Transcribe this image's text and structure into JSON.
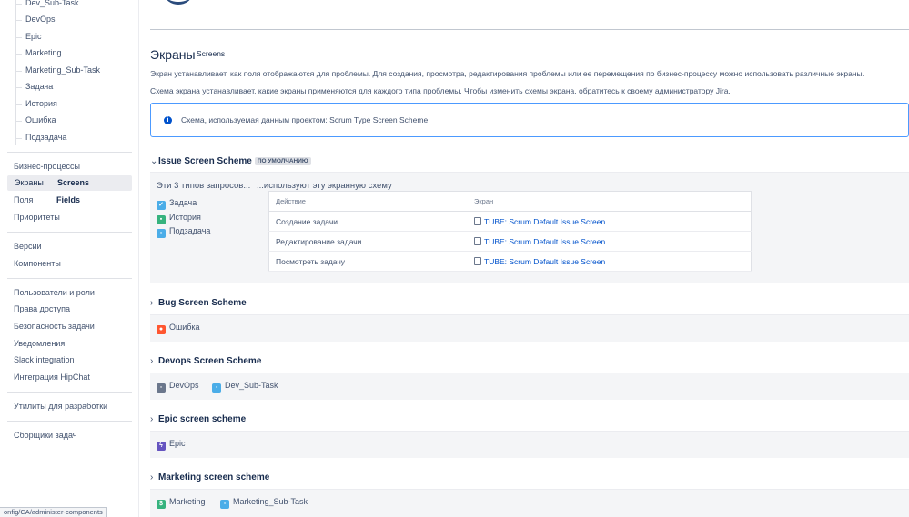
{
  "sidebar": {
    "sub_items": [
      "Dev_Sub-Task",
      "DevOps",
      "Epic",
      "Marketing",
      "Marketing_Sub-Task",
      "Задача",
      "История",
      "Ошибка",
      "Подзадача"
    ],
    "group1": [
      {
        "label": "Бизнес-процессы"
      },
      {
        "label": "Экраны",
        "en": "Screens"
      },
      {
        "label": "Поля",
        "en": "Fields"
      },
      {
        "label": "Приоритеты"
      }
    ],
    "group2": [
      "Версии",
      "Компоненты"
    ],
    "group3": [
      "Пользователи и роли",
      "Права доступа",
      "Безопасность задачи",
      "Уведомления",
      "Slack integration",
      "Интеграция HipChat"
    ],
    "group4": [
      "Утилиты для разработки"
    ],
    "group5": [
      "Сборщики задач"
    ]
  },
  "statusbar": "onfig/CA/administer-components",
  "main": {
    "title": "Экраны",
    "title_en": "Screens",
    "desc1": "Экран устанавливает, как поля отображаются для проблемы. Для создания, просмотра, редактирования проблемы или ее перемещения по бизнес-процессу можно использовать различные экраны.",
    "desc2": "Схема экрана устанавливает, какие экраны применяются для каждого типа проблемы. Чтобы изменить схемы экрана, обратитесь к своему администратору Jira.",
    "info": "Схема, используемая данным проектом: Scrum Type Screen Scheme"
  },
  "schemes": {
    "issue": {
      "title": "Issue Screen Scheme",
      "badge": "ПО УМОЛЧАНИЮ",
      "types_head": "Эти 3 типов запросов...",
      "uses_head": "...используют эту экранную схему",
      "types": [
        "Задача",
        "История",
        "Подзадача"
      ],
      "col_action": "Действие",
      "col_screen": "Экран",
      "rows": [
        {
          "action": "Создание задачи",
          "screen": "TUBE: Scrum Default Issue Screen"
        },
        {
          "action": "Редактирование задачи",
          "screen": "TUBE: Scrum Default Issue Screen"
        },
        {
          "action": "Посмотреть задачу",
          "screen": "TUBE: Scrum Default Issue Screen"
        }
      ]
    },
    "bug": {
      "title": "Bug Screen Scheme",
      "types": [
        "Ошибка"
      ]
    },
    "devops": {
      "title": "Devops Screen Scheme",
      "types": [
        "DevOps",
        "Dev_Sub-Task"
      ]
    },
    "epic": {
      "title": "Epic screen scheme",
      "types": [
        "Epic"
      ]
    },
    "marketing": {
      "title": "Marketing screen scheme",
      "types": [
        "Marketing",
        "Marketing_Sub-Task"
      ]
    }
  },
  "colors": {
    "link": "#0052cc",
    "info_border": "#4c9aff",
    "panel_bg": "#f4f5f7"
  }
}
